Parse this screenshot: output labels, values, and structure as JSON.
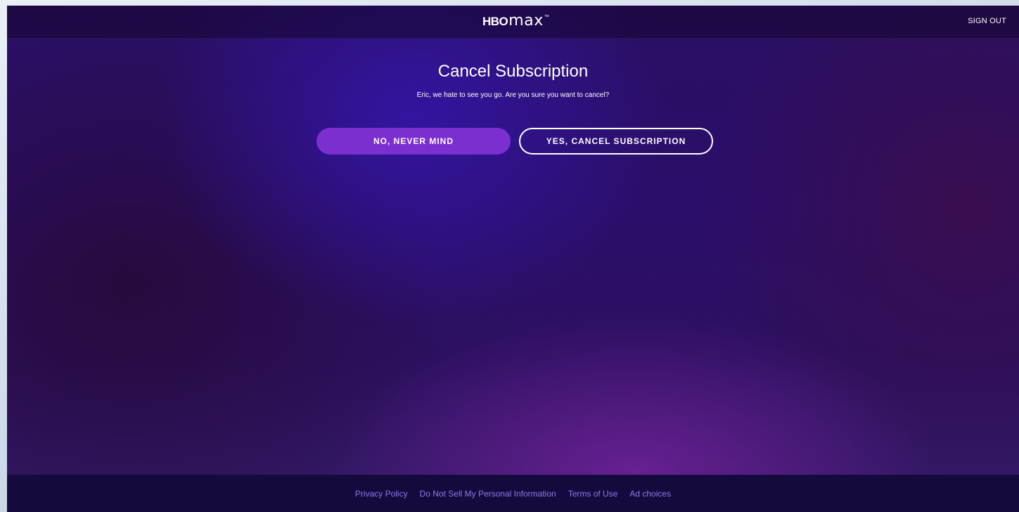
{
  "header": {
    "logo_hbo": "HBO",
    "logo_max": "max",
    "logo_tm": "™",
    "sign_out": "SIGN OUT"
  },
  "main": {
    "title": "Cancel Subscription",
    "subtitle": "Eric, we hate to see you go. Are you sure you want to cancel?",
    "no_button": "NO, NEVER MIND",
    "yes_button": "YES, CANCEL SUBSCRIPTION"
  },
  "footer": {
    "links": [
      "Privacy Policy",
      "Do Not Sell My Personal Information",
      "Terms of Use",
      "Ad choices"
    ]
  },
  "colors": {
    "primary_button": "#7b2fd0",
    "footer_link": "#8f7be8",
    "footer_bg": "#140a3d"
  }
}
